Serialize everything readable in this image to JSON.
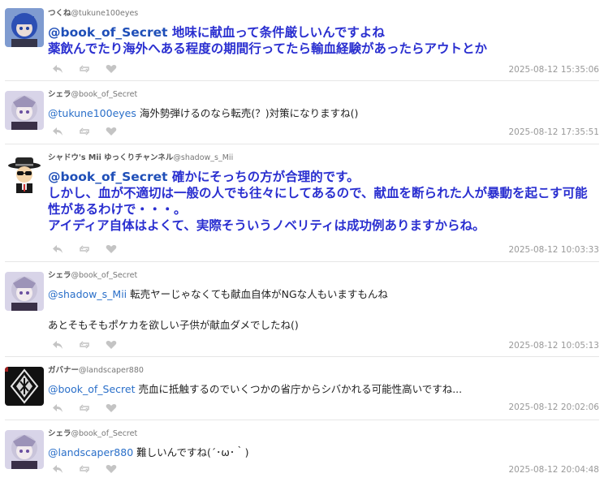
{
  "posts": [
    {
      "display_name": "つくね",
      "handle": "@tukune100eyes",
      "avatar": "blue-hair-girl-avatar",
      "style": "bold",
      "mention": "@book_of_Secret",
      "text": " 地味に献血って条件厳しいんですよね\n薬飲んでたり海外へある程度の期間行ってたら輸血経験があったらアウトとか",
      "timestamp": "2025-08-12 15:35:06"
    },
    {
      "display_name": "シェラ",
      "handle": "@book_of_Secret",
      "avatar": "silver-hair-girl-avatar",
      "style": "normal",
      "mention": "@tukune100eyes",
      "text": " 海外勢弾けるのなら転売(？)対策になりますね()",
      "timestamp": "2025-08-12 17:35:51"
    },
    {
      "display_name": "シャドウ's Mii ゆっくりチャンネル",
      "handle": "@shadow_s_Mii",
      "avatar": "mii-hat-avatar",
      "style": "bold",
      "mention": "@book_of_Secret",
      "text": " 確かにそっちの方が合理的です。\nしかし、血が不適切は一般の人でも往々にしてあるので、献血を断られた人が暴動を起こす可能性があるわけで・・・。\nアイディア自体はよくて、実際そういうノベリティは成功例ありますからね。",
      "timestamp": "2025-08-12 10:03:33"
    },
    {
      "display_name": "シェラ",
      "handle": "@book_of_Secret",
      "avatar": "silver-hair-girl-avatar",
      "style": "normal",
      "mention": "@shadow_s_Mii",
      "text": " 転売ヤーじゃなくても献血自体がNGな人もいますもんね\n\nあとそもそもポケカを欲しい子供が献血ダメでしたね()",
      "timestamp": "2025-08-12 10:05:13"
    },
    {
      "display_name": "ガバナー",
      "handle": "@landscaper880",
      "avatar": "dark-emblem-avatar",
      "style": "normal",
      "mention": "@book_of_Secret",
      "text": " 売血に抵触するのでいくつかの省庁からシバかれる可能性高いですね...",
      "timestamp": "2025-08-12 20:02:06"
    },
    {
      "display_name": "シェラ",
      "handle": "@book_of_Secret",
      "avatar": "silver-hair-girl-avatar",
      "style": "normal",
      "mention": "@landscaper880",
      "text": " 難しいんですね(´･ω･｀)",
      "timestamp": "2025-08-12 20:04:48"
    }
  ],
  "colors": {
    "bold_text": "#2a2fd0",
    "mention": "#2a6fc9",
    "timestamp": "#999999",
    "divider": "#e6e6e6",
    "icon": "#c4c4c4"
  },
  "action_icons": [
    "reply-icon",
    "repost-icon",
    "like-icon"
  ]
}
